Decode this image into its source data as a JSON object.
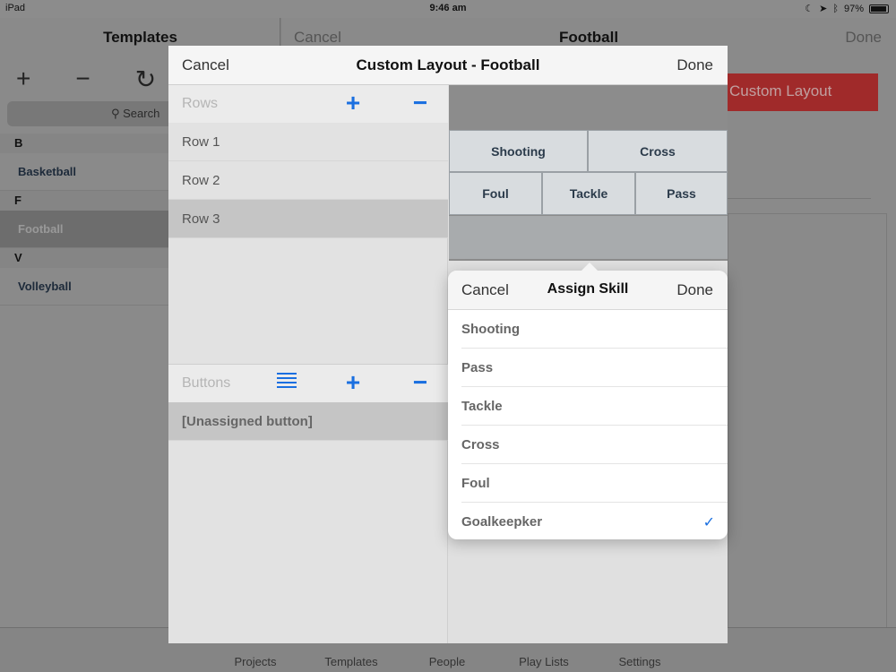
{
  "status_bar": {
    "device": "iPad",
    "time": "9:46 am",
    "battery": "97%"
  },
  "background": {
    "left_title": "Templates",
    "search_placeholder": "Search",
    "sections": [
      {
        "letter": "B",
        "items": [
          "Basketball"
        ]
      },
      {
        "letter": "F",
        "items": [
          "Football"
        ]
      },
      {
        "letter": "V",
        "items": [
          "Volleyball"
        ]
      }
    ],
    "right_cancel": "Cancel",
    "right_title": "Football",
    "right_done": "Done",
    "red_button": "Custom Layout"
  },
  "tabs": [
    "Projects",
    "Templates",
    "People",
    "Play Lists",
    "Settings"
  ],
  "modal": {
    "cancel": "Cancel",
    "title": "Custom Layout - Football",
    "done": "Done",
    "rows_label": "Rows",
    "rows": [
      "Row 1",
      "Row 2",
      "Row 3"
    ],
    "selected_row": "Row 3",
    "buttons_label": "Buttons",
    "buttons": [
      "[Unassigned button]"
    ],
    "grid": {
      "row1": [
        "Shooting",
        "Cross"
      ],
      "row2": [
        "Foul",
        "Tackle",
        "Pass"
      ]
    }
  },
  "popover": {
    "cancel": "Cancel",
    "title": "Assign Skill",
    "done": "Done",
    "skills": [
      "Shooting",
      "Pass",
      "Tackle",
      "Cross",
      "Foul",
      "Goalkeepker"
    ],
    "checked": "Goalkeepker"
  },
  "colors": {
    "accent": "#1a6fe0",
    "brand_red": "#d33a3a"
  }
}
